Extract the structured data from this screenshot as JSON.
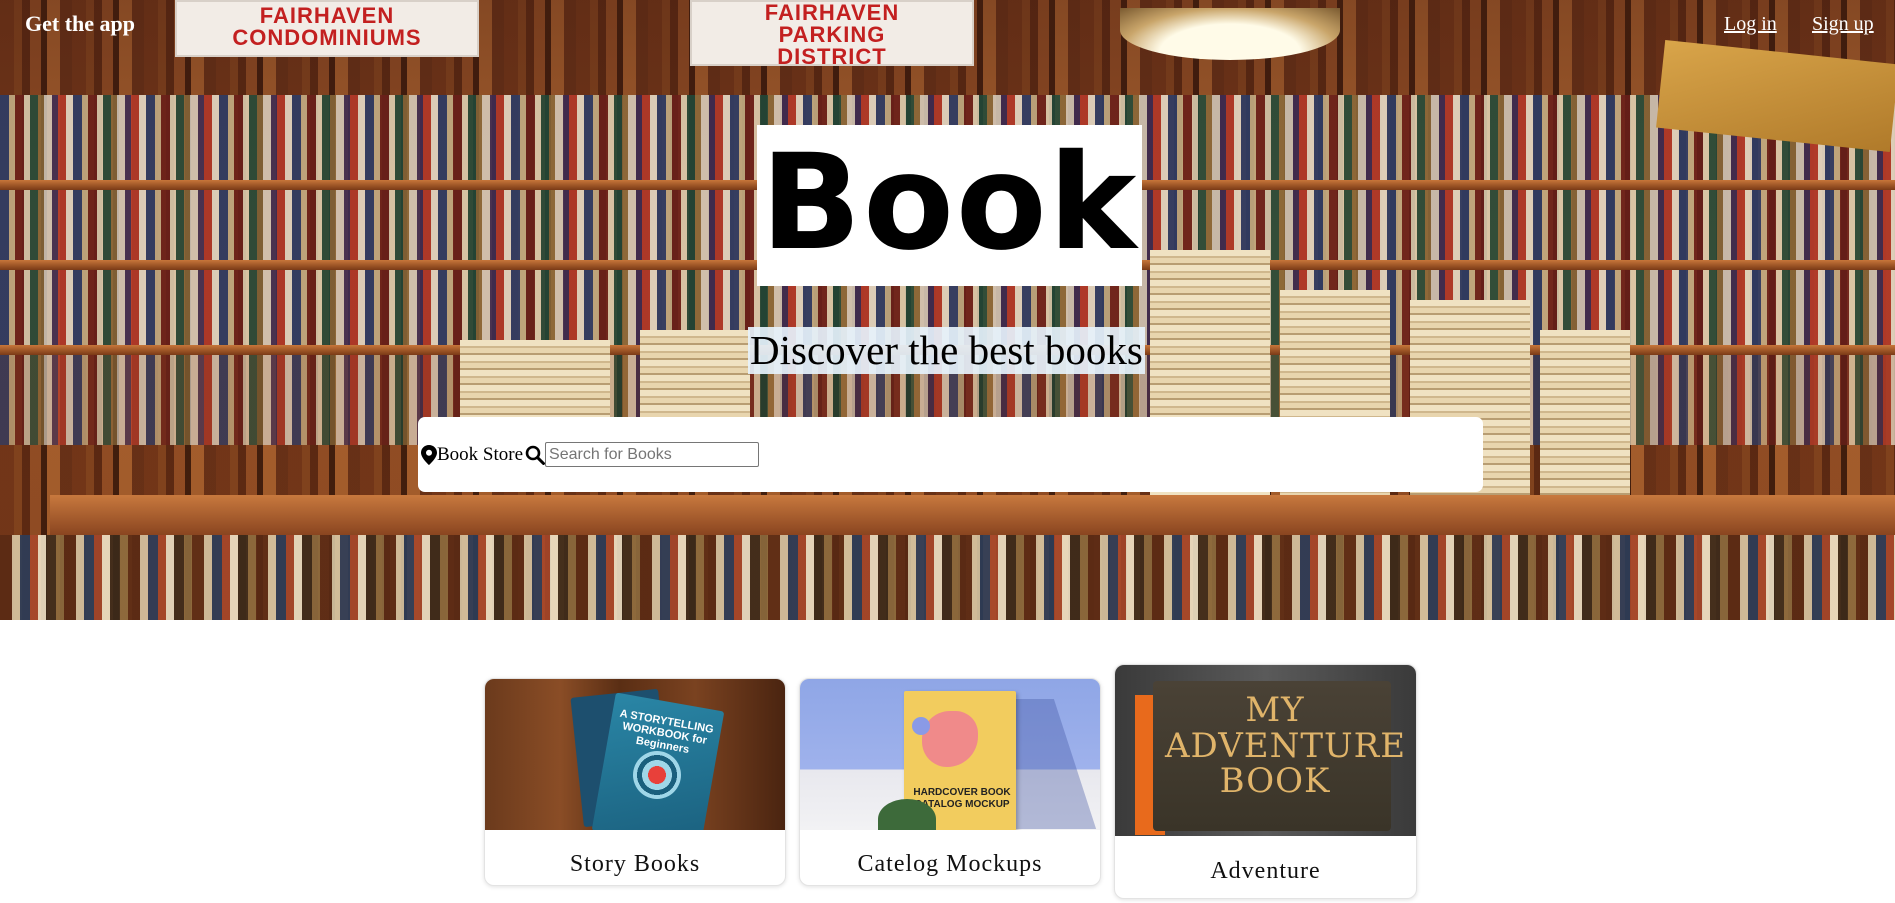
{
  "nav": {
    "get_app": "Get the app",
    "login": "Log in",
    "signup": "Sign up"
  },
  "hero": {
    "logo": "Book",
    "tagline": "Discover the best books",
    "signs": [
      {
        "line1": "FAIRHAVEN",
        "line2": "CONDOMINIUMS"
      },
      {
        "line1": "FAIRHAVEN",
        "line2": "PARKING",
        "line3": "DISTRICT"
      }
    ]
  },
  "search": {
    "location_label": "Book Store",
    "placeholder": "Search for Books",
    "value": "",
    "location_icon": "map-pin-icon",
    "search_icon": "magnifier-icon"
  },
  "cards": [
    {
      "title": "Story Books",
      "cover_text": "A STORYTELLING WORKBOOK for Beginners"
    },
    {
      "title": "Catelog Mockups",
      "cover_text": "HARDCOVER BOOK CATALOG MOCKUP"
    },
    {
      "title": "Adventure",
      "cover_text": "MY ADVENTURE BOOK"
    }
  ]
}
